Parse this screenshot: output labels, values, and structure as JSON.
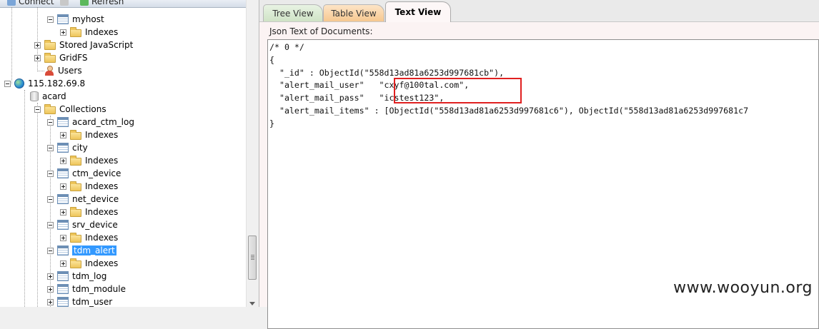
{
  "toolbar": {
    "connect_label": "Connect",
    "refresh_label": "Refresh"
  },
  "tree": {
    "myhost": "myhost",
    "indexes": "Indexes",
    "stored_js": "Stored JavaScript",
    "gridfs": "GridFS",
    "users": "Users",
    "server": "115.182.69.8",
    "database": "acard",
    "collections": "Collections",
    "items": [
      "acard_ctm_log",
      "city",
      "ctm_device",
      "net_device",
      "srv_device",
      "tdm_alert",
      "tdm_log",
      "tdm_module",
      "tdm_user"
    ]
  },
  "tabs": {
    "tree": "Tree View",
    "table": "Table View",
    "text": "Text View"
  },
  "panel": {
    "label": "Json Text of Documents:"
  },
  "code": {
    "line1": "/* 0 */",
    "line2": "{",
    "line3": "  \"_id\" : ObjectId(\"558d13ad81a6253d997681cb\"),",
    "line4": "  \"alert_mail_user\"   \"cxyf@100tal.com\",",
    "line5": "  \"alert_mail_pass\"   \"icstest123\",",
    "line6": "  \"alert_mail_items\" : [ObjectId(\"558d13ad81a6253d997681c6\"), ObjectId(\"558d13ad81a6253d997681c7",
    "line7": "}"
  },
  "watermark": "www.wooyun.org",
  "colors": {
    "selection": "#3399ff",
    "highlight_box": "#e02020"
  }
}
